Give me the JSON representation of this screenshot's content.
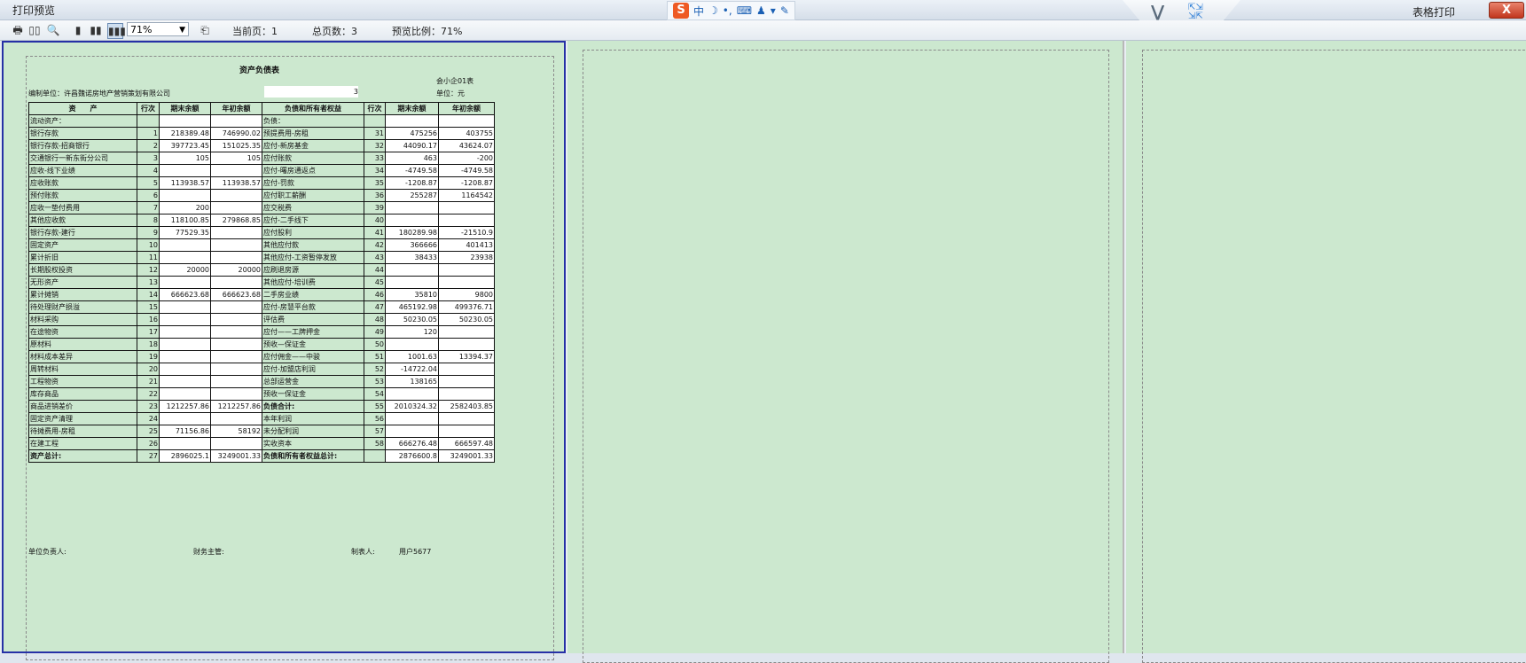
{
  "window": {
    "title": "打印预览",
    "right_title": "表格打印",
    "close_label": "X"
  },
  "ime": {
    "lang": "中",
    "symbols": [
      "🌙",
      "•",
      "⌨",
      "⚙",
      "👕",
      "🔧"
    ]
  },
  "toolbar": {
    "zoom_value": "71%",
    "current_page_label": "当前页：1",
    "total_pages_label": "总页数：3",
    "preview_ratio_label": "预览比例：71%"
  },
  "doc": {
    "title": "资产负债表",
    "code": "会小企01表",
    "org_label": "编制单位：许昌魏诺房地产营销策划有限公司",
    "org_value": "3",
    "unit_label": "单位：元",
    "headers": [
      "资　　产",
      "行次",
      "期末余额",
      "年初余额",
      "负债和所有者权益",
      "行次",
      "期末余额",
      "年初余额"
    ],
    "rows": [
      [
        "流动资产：",
        "",
        "",
        "",
        "负债：",
        "",
        "",
        ""
      ],
      [
        "银行存款",
        "1",
        "218389.48",
        "746990.02",
        "预提费用-房租",
        "31",
        "475256",
        "403755"
      ],
      [
        "银行存款-招商银行",
        "2",
        "397723.45",
        "151025.35",
        "应付-新房基金",
        "32",
        "44090.17",
        "43624.07"
      ],
      [
        "交通银行一新东街分公司",
        "3",
        "105",
        "105",
        "应付账款",
        "33",
        "463",
        "-200"
      ],
      [
        "应收-线下业绩",
        "4",
        "",
        "",
        "应付-曙房通返点",
        "34",
        "-4749.58",
        "-4749.58"
      ],
      [
        "应收账款",
        "5",
        "113938.57",
        "113938.57",
        "应付-罚款",
        "35",
        "-1208.87",
        "-1208.87"
      ],
      [
        "预付账款",
        "6",
        "",
        "",
        "应付职工薪酬",
        "36",
        "255287",
        "1164542"
      ],
      [
        "应收一垫付费用",
        "7",
        "200",
        "",
        "应交税费",
        "39",
        "",
        ""
      ],
      [
        "其他应收款",
        "8",
        "118100.85",
        "279868.85",
        "应付-二手线下",
        "40",
        "",
        ""
      ],
      [
        "银行存款-建行",
        "9",
        "77529.35",
        "",
        "应付股利",
        "41",
        "180289.98",
        "-21510.9"
      ],
      [
        "固定资产",
        "10",
        "",
        "",
        "其他应付款",
        "42",
        "366666",
        "401413"
      ],
      [
        "累计折旧",
        "11",
        "",
        "",
        "其他应付-工资暂停发放",
        "43",
        "38433",
        "23938"
      ],
      [
        "长期股权投资",
        "12",
        "20000",
        "20000",
        "应刷退房源",
        "44",
        "",
        ""
      ],
      [
        "无形资产",
        "13",
        "",
        "",
        "其他应付-培训费",
        "45",
        "",
        ""
      ],
      [
        "累计摊销",
        "14",
        "666623.68",
        "666623.68",
        "二手房业绩",
        "46",
        "35810",
        "9800"
      ],
      [
        "待处理财产损溢",
        "15",
        "",
        "",
        "应付-房慧平台款",
        "47",
        "465192.98",
        "499376.71"
      ],
      [
        "材料采购",
        "16",
        "",
        "",
        "评估费",
        "48",
        "50230.05",
        "50230.05"
      ],
      [
        "在途物资",
        "17",
        "",
        "",
        "应付——工牌押金",
        "49",
        "120",
        ""
      ],
      [
        "原材料",
        "18",
        "",
        "",
        "预收—保证金",
        "50",
        "",
        ""
      ],
      [
        "材料成本差异",
        "19",
        "",
        "",
        "应付佣金——中骏",
        "51",
        "1001.63",
        "13394.37"
      ],
      [
        "周转材料",
        "20",
        "",
        "",
        "应付-加盟店利润",
        "52",
        "-14722.04",
        ""
      ],
      [
        "工程物资",
        "21",
        "",
        "",
        "总部运营金",
        "53",
        "138165",
        ""
      ],
      [
        "库存商品",
        "22",
        "",
        "",
        "预收一保证金",
        "54",
        "",
        ""
      ],
      [
        "商品进销差价",
        "23",
        "1212257.86",
        "1212257.86",
        "负债合计:",
        "55",
        "2010324.32",
        "2582403.85"
      ],
      [
        "固定资产清理",
        "24",
        "",
        "",
        "本年利润",
        "56",
        "",
        ""
      ],
      [
        "待摊费用-房租",
        "25",
        "71156.86",
        "58192",
        "未分配利润",
        "57",
        "",
        ""
      ],
      [
        "在建工程",
        "26",
        "",
        "",
        "实收资本",
        "58",
        "666276.48",
        "666597.48"
      ],
      [
        "资产总计:",
        "27",
        "2896025.1",
        "3249001.33",
        "负债和所有者权益总计:",
        "",
        "2876600.8",
        "3249001.33"
      ]
    ],
    "footer": {
      "principal": "单位负责人:",
      "finance": "财务主管:",
      "preparer": "制表人:",
      "user": "用户5677"
    }
  },
  "colors": {
    "page": "#cce8cf",
    "active_border": "#2630a6"
  }
}
